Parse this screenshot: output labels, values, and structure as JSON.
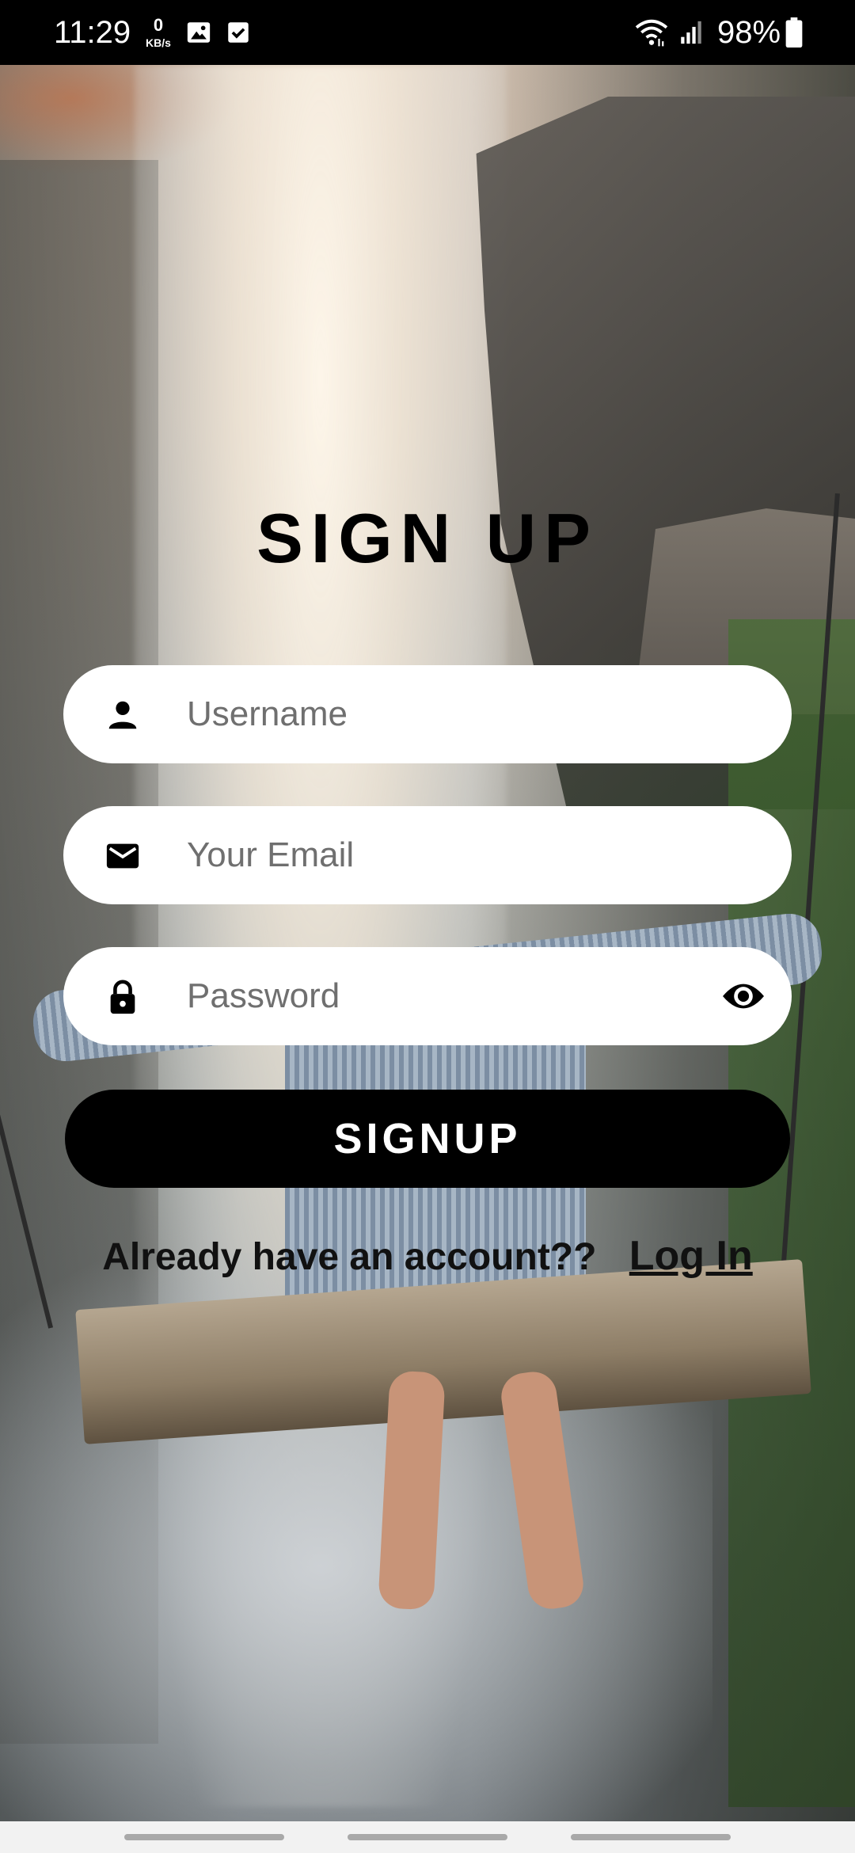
{
  "status_bar": {
    "time": "11:29",
    "network_speed_value": "0",
    "network_speed_unit": "KB/s",
    "battery_percent": "98%"
  },
  "form": {
    "title": "SIGN UP",
    "username_placeholder": "Username",
    "email_placeholder": "Your Email",
    "password_placeholder": "Password",
    "submit_label": "SIGNUP",
    "login_prompt": "Already have an account??",
    "login_link": "Log In"
  },
  "icons": {
    "username": "person-icon",
    "email": "mail-icon",
    "password": "lock-icon",
    "toggle": "eye-icon"
  },
  "colors": {
    "button_bg": "#000000",
    "field_bg": "#ffffff",
    "placeholder": "#6f6f6f"
  }
}
